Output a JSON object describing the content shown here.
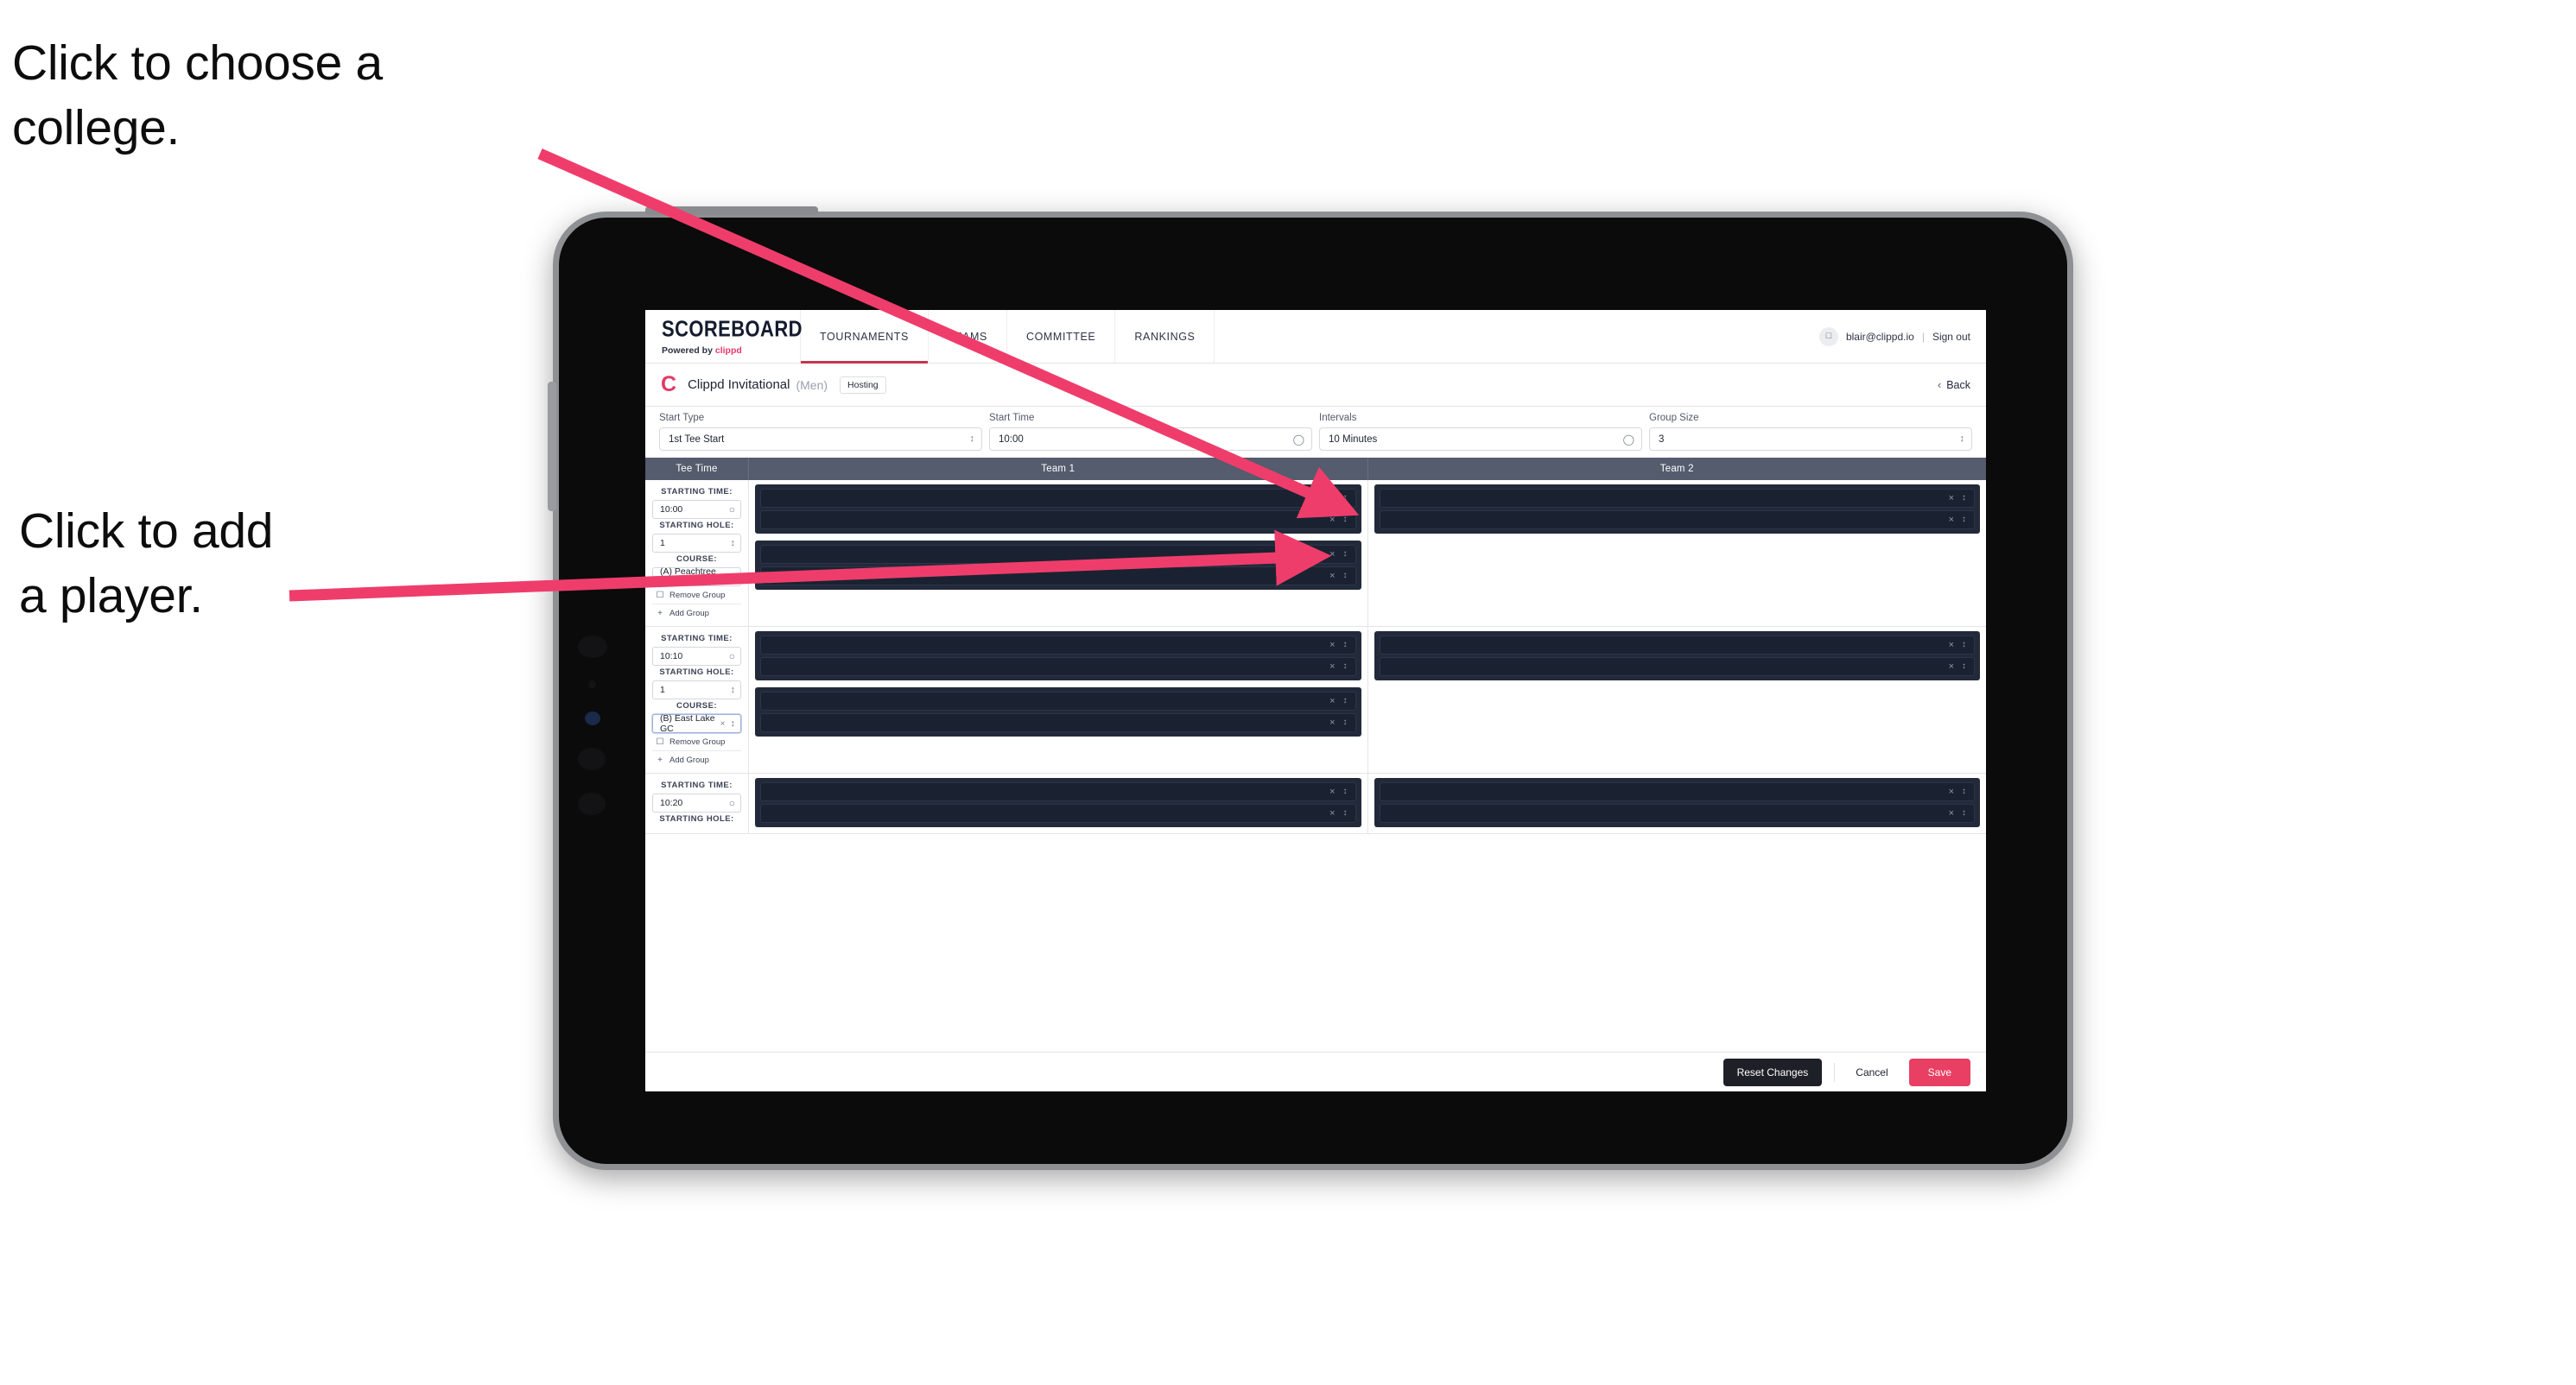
{
  "annotations": {
    "college": "Click to choose a\ncollege.",
    "player": "Click to add\na player."
  },
  "colors": {
    "accent_pink": "#e83f63",
    "annotation_arrow": "#ef3d6b",
    "table_header": "#545c6d",
    "dark_group": "#222a3a",
    "nav_active_underline": "#c4384f"
  },
  "topnav": {
    "brand": "SCOREBOARD",
    "brand_sub_prefix": "Powered by",
    "brand_sub_name": "clippd",
    "tabs": [
      {
        "label": "TOURNAMENTS",
        "active": true
      },
      {
        "label": "TEAMS",
        "active": false
      },
      {
        "label": "COMMITTEE",
        "active": false
      },
      {
        "label": "RANKINGS",
        "active": false
      }
    ],
    "avatar_icon": "user-avatar-icon",
    "user_email": "blair@clippd.io",
    "separator": "|",
    "sign_out": "Sign out"
  },
  "tournament_header": {
    "logo_letter": "C",
    "name": "Clippd Invitational",
    "gender": "(Men)",
    "badge": "Hosting",
    "back_chevron": "‹",
    "back_label": "Back"
  },
  "settings": {
    "fields": [
      {
        "label": "Start Type",
        "value": "1st Tee Start",
        "control": "stepper"
      },
      {
        "label": "Start Time",
        "value": "10:00",
        "control": "clock"
      },
      {
        "label": "Intervals",
        "value": "10 Minutes",
        "control": "clock"
      },
      {
        "label": "Group Size",
        "value": "3",
        "control": "stepper"
      }
    ]
  },
  "table": {
    "columns": [
      "Tee Time",
      "Team 1",
      "Team 2"
    ],
    "labels": {
      "starting_time": "STARTING TIME:",
      "starting_hole": "STARTING HOLE:",
      "course": "COURSE:",
      "remove_group": "Remove Group",
      "add_group": "Add Group"
    },
    "rows": [
      {
        "starting_time": "10:00",
        "starting_hole": "1",
        "course": "(A) Peachtree GC",
        "course_focused": false,
        "team1_groups": [
          {
            "players": [
              "",
              ""
            ]
          },
          {
            "players": [
              "",
              ""
            ]
          }
        ],
        "team2_groups": [
          {
            "players": [
              "",
              ""
            ]
          }
        ]
      },
      {
        "starting_time": "10:10",
        "starting_hole": "1",
        "course": "(B) East Lake GC",
        "course_focused": true,
        "team1_groups": [
          {
            "players": [
              "",
              ""
            ]
          },
          {
            "players": [
              "",
              ""
            ]
          }
        ],
        "team2_groups": [
          {
            "players": [
              "",
              ""
            ]
          }
        ]
      },
      {
        "starting_time": "10:20",
        "starting_hole": "",
        "course": "",
        "course_focused": false,
        "team1_groups": [
          {
            "players": [
              "",
              ""
            ]
          }
        ],
        "team2_groups": [
          {
            "players": [
              "",
              ""
            ]
          }
        ]
      }
    ]
  },
  "footer": {
    "reset": "Reset Changes",
    "cancel": "Cancel",
    "save": "Save"
  }
}
